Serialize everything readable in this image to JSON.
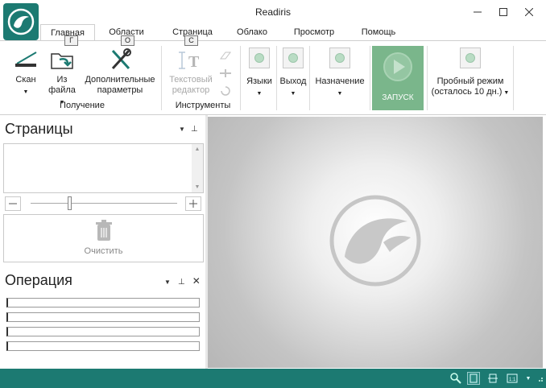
{
  "window": {
    "title": "Readiris"
  },
  "tabs": [
    {
      "label": "Главная",
      "keytip": "Г"
    },
    {
      "label": "Области",
      "keytip": "О"
    },
    {
      "label": "Страница",
      "keytip": "С"
    },
    {
      "label": "Облако"
    },
    {
      "label": "Просмотр"
    },
    {
      "label": "Помощь"
    }
  ],
  "ribbon": {
    "scan": "Скан",
    "from_file_1": "Из",
    "from_file_2": "файла",
    "settings_1": "Дополнительные",
    "settings_2": "параметры",
    "group_acquire": "Получение",
    "text_editor_1": "Текстовый",
    "text_editor_2": "редактор",
    "group_tools": "Инструменты",
    "languages": "Языки",
    "output": "Выход",
    "destination": "Назначение",
    "run": "ЗАПУСК",
    "trial_1": "Пробный режим",
    "trial_2": "(осталось 10 дн.)"
  },
  "pages_pane": {
    "title": "Страницы",
    "clear": "Очистить"
  },
  "operation_pane": {
    "title": "Операция"
  }
}
